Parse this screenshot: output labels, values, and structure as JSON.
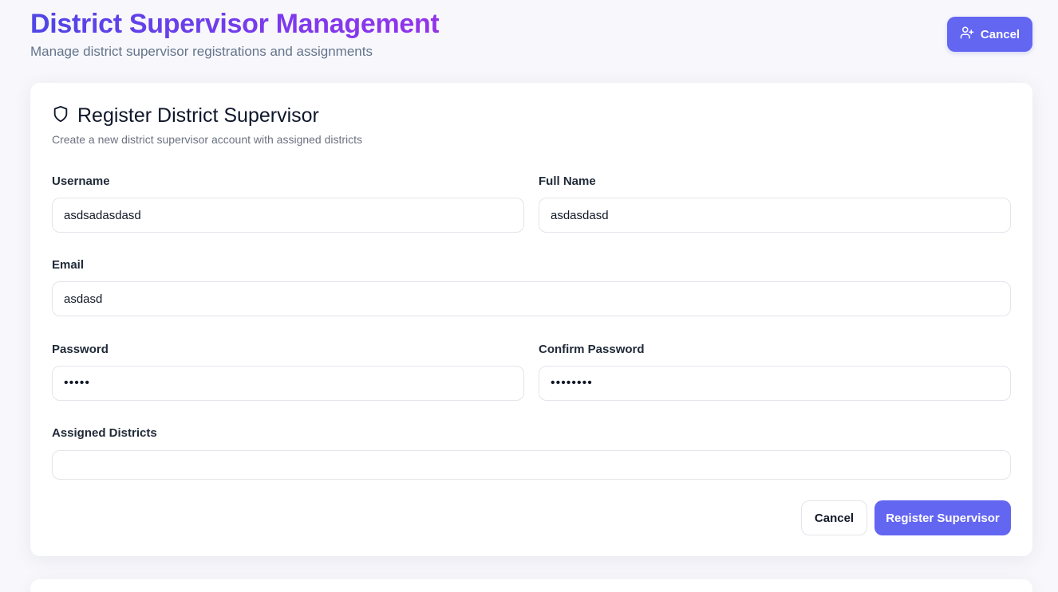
{
  "header": {
    "title": "District Supervisor Management",
    "subtitle": "Manage district supervisor registrations and assignments",
    "action_button": {
      "label": "Cancel",
      "icon": "user-plus-icon"
    }
  },
  "form": {
    "title": "Register District Supervisor",
    "title_icon": "shield-icon",
    "description": "Create a new district supervisor account with assigned districts",
    "fields": {
      "username": {
        "label": "Username",
        "value": "asdsadasdasd"
      },
      "full_name": {
        "label": "Full Name",
        "value": "asdasdasd"
      },
      "email": {
        "label": "Email",
        "value": "asdasd"
      },
      "password": {
        "label": "Password",
        "value": "•••••"
      },
      "confirm_password": {
        "label": "Confirm Password",
        "value": "••••••••"
      },
      "assigned_districts": {
        "label": "Assigned Districts",
        "value": ""
      }
    },
    "cancel_label": "Cancel",
    "submit_label": "Register Supervisor"
  },
  "colors": {
    "accent": "#6366f1",
    "title_gradient_start": "#4f46e5",
    "title_gradient_end": "#9333ea"
  }
}
